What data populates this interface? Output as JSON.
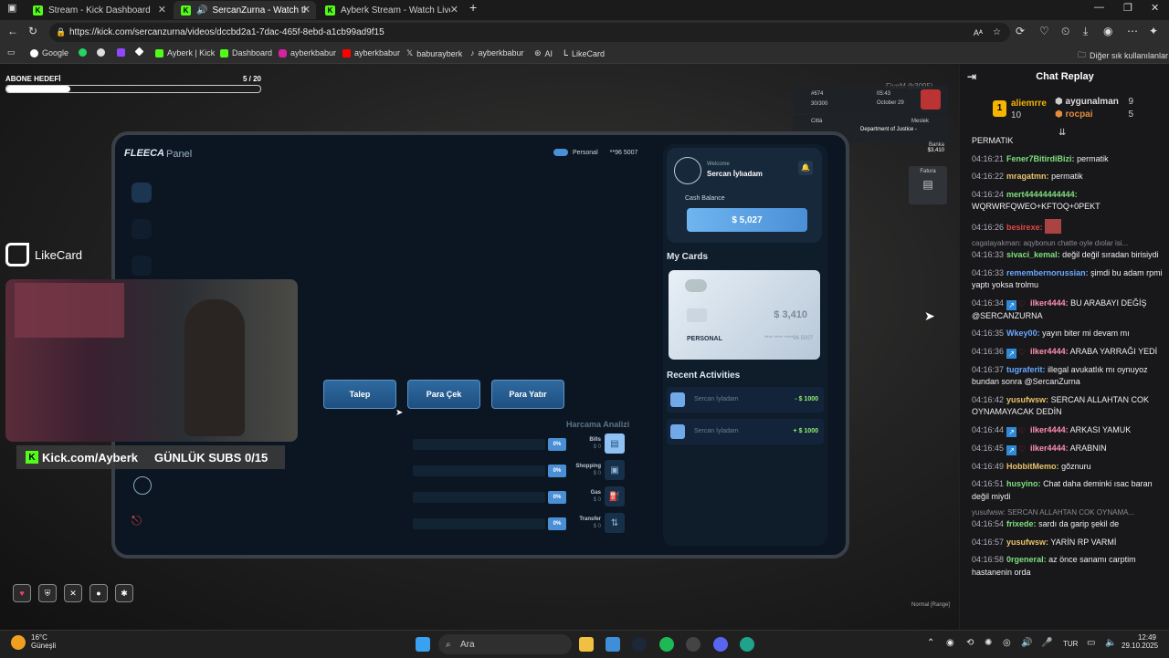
{
  "tabs": [
    {
      "title": "Stream - Kick Dashboard",
      "active": false
    },
    {
      "title": "SercanZurna - Watch the VO",
      "active": true
    },
    {
      "title": "Ayberk Stream - Watch Live on K",
      "active": false
    }
  ],
  "url": "https://kick.com/sercanzurna/videos/dccbd2a1-7dac-465f-8ebd-a1cb99ad9f15",
  "bookmarks": [
    {
      "label": "Google"
    },
    {
      "label": "Ayberk | Kick"
    },
    {
      "label": "Dashboard"
    },
    {
      "label": "ayberkbabur"
    },
    {
      "label": "ayberkbabur"
    },
    {
      "label": "baburayberk"
    },
    {
      "label": "ayberkbabur"
    },
    {
      "label": "AI"
    },
    {
      "label": "LikeCard"
    }
  ],
  "other_bookmarks": "Diğer sık kullanılanlar",
  "overlay": {
    "abone_label": "ABONE HEDEFİ",
    "abone_count": "5 / 20",
    "abone_progress": 0.25,
    "likecard": "LikeCard",
    "kick_link": "Kick.com/Ayberk",
    "daily_subs": "GÜNLÜK SUBS 0/15",
    "normal_range": "Normal [Range]",
    "fivem": "FiveM (b3095)"
  },
  "hud": {
    "id": "#674",
    "ratio": "30/300",
    "time": "05:43",
    "date": "October 29",
    "city": "Città",
    "job_label": "Meslek",
    "job": "Department of Justice -",
    "bank_label": "Banka",
    "bank": "$3,410",
    "fatura": "Fatura"
  },
  "tablet": {
    "brand": "FLEECA",
    "title": "Panel",
    "mode": "Personal",
    "account": "**96 5007",
    "welcome": "Welcome",
    "user": "Sercan İylıadam",
    "cash_label": "Cash Balance",
    "cash": "$ 5,027",
    "my_cards": "My Cards",
    "card_balance": "$ 3,410",
    "card_type": "PERSONAL",
    "card_number": "**** **** ****96 5007",
    "recent": "Recent Activities",
    "activities": [
      {
        "name": "Sercan İyladam",
        "amount": "- $ 1000"
      },
      {
        "name": "Sercan İyladam",
        "amount": "+ $ 1000"
      }
    ],
    "buttons": [
      "Talep",
      "Para Çek",
      "Para Yatır"
    ],
    "harcama_title": "Harcama Analizi",
    "harcama": [
      {
        "label": "Bills",
        "value": "$ 0",
        "pct": "0%"
      },
      {
        "label": "Shopping",
        "value": "$ 0",
        "pct": "0%"
      },
      {
        "label": "Gas",
        "value": "$ 0",
        "pct": "0%"
      },
      {
        "label": "Transfer",
        "value": "$ 0",
        "pct": "0%"
      }
    ]
  },
  "chat": {
    "title": "Chat Replay",
    "top": [
      {
        "name": "aliemrre",
        "count": "10",
        "rank": "1"
      },
      {
        "name": "aygunalman",
        "count": "9"
      },
      {
        "name": "rocpai",
        "count": "5"
      }
    ],
    "messages": [
      {
        "ts": "",
        "user": "",
        "text": "PERMATIK",
        "color": "#efeff1"
      },
      {
        "ts": "04:16:21",
        "user": "Fener7BitirdiBizi:",
        "text": "permatik",
        "color": "#7ee07e"
      },
      {
        "ts": "04:16:22",
        "user": "mragatmn:",
        "text": "permatik",
        "color": "#e8c26a"
      },
      {
        "ts": "04:16:24",
        "user": "mert44444444444:",
        "text": "WQRWRFQWEO+KFTOQ+0PEKT",
        "color": "#7ee07e"
      },
      {
        "ts": "04:16:26",
        "user": "besirexe:",
        "text": "",
        "color": "#e04646",
        "emote": true
      },
      {
        "ts": "04:16:33",
        "user": "sivaci_kemal:",
        "text": "değil değil sıradan birisiydi",
        "color": "#7ee07e",
        "reply": "cagatayakman: aqybonun chatte oyle dıolar isi..."
      },
      {
        "ts": "04:16:33",
        "user": "remembernorussian:",
        "text": "şimdi bu adam rpmi yaptı yoksa trolmu",
        "color": "#6aa8ff"
      },
      {
        "ts": "04:16:34",
        "user": "ilker4444:",
        "text": "BU ARABAYI DEĞİŞ @SERCANZURNA",
        "color": "#ff8fb0",
        "badges": true
      },
      {
        "ts": "04:16:35",
        "user": "Wkey00:",
        "text": "yayın biter mi devam mı",
        "color": "#6aa8ff"
      },
      {
        "ts": "04:16:36",
        "user": "ilker4444:",
        "text": "ARABA YARRAĞI YEDİ",
        "color": "#ff8fb0",
        "badges": true
      },
      {
        "ts": "04:16:37",
        "user": "tugraferit:",
        "text": "illegal avukatlık mı oynuyoz bundan sonra @SercanZurna",
        "color": "#6aa8ff"
      },
      {
        "ts": "04:16:42",
        "user": "yusufwsw:",
        "text": "SERCAN ALLAHTAN COK OYNAMAYACAK DEDİN",
        "color": "#e8c26a"
      },
      {
        "ts": "04:16:44",
        "user": "ilker4444:",
        "text": "ARKASI YAMUK",
        "color": "#ff8fb0",
        "badges": true
      },
      {
        "ts": "04:16:45",
        "user": "ilker4444:",
        "text": "ARABNIN",
        "color": "#ff8fb0",
        "badges": true
      },
      {
        "ts": "04:16:49",
        "user": "HobbitMemo:",
        "text": "gõznuru",
        "color": "#e8c26a"
      },
      {
        "ts": "04:16:51",
        "user": "husyino:",
        "text": "Chat daha deminki ısac baran değil miydi",
        "color": "#7ee07e"
      },
      {
        "ts": "04:16:54",
        "user": "frixede:",
        "text": "sardı da garip şekil de",
        "color": "#7ee07e",
        "reply": "yusufwsw: SERCAN ALLAHTAN COK OYNAMA..."
      },
      {
        "ts": "04:16:57",
        "user": "yusufwsw:",
        "text": "YARİN RP VARMİ",
        "color": "#e8c26a"
      },
      {
        "ts": "04:16:58",
        "user": "0rgeneral:",
        "text": "az önce sanamı carptim hastanenin orda",
        "color": "#7ee07e"
      }
    ]
  },
  "taskbar": {
    "weather_temp": "16°C",
    "weather_desc": "Güneşli",
    "search": "Ara",
    "lang": "TUR",
    "time": "12:49",
    "date": "29.10.2025"
  }
}
